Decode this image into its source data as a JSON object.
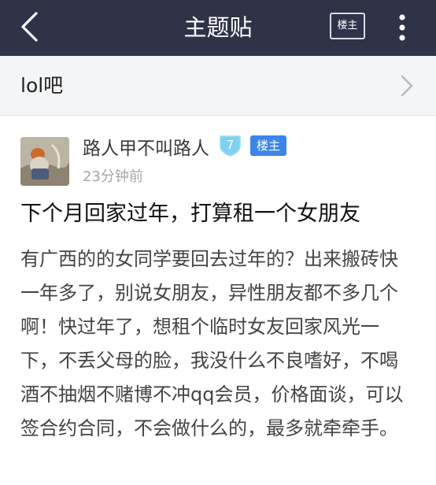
{
  "header": {
    "title": "主题贴",
    "op_only_label": "楼主",
    "back_icon": "back-arrow-icon",
    "more_icon": "more-vertical-icon",
    "background": "#2e3347"
  },
  "forum": {
    "name": "lol吧"
  },
  "post": {
    "author": "路人甲不叫路人",
    "level": "7",
    "op_badge": "楼主",
    "time": "23分钟前",
    "title": "下个月回家过年，打算租一个女朋友",
    "body": "有广西的的女同学要回去过年的？出来搬砖快一年多了，别说女朋友，异性朋友都不多几个啊！快过年了，想租个临时女友回家风光一下，不丢父母的脸，我没什么不良嗜好，不喝酒不抽烟不赌博不冲qq会员，价格面谈，可以签合约合同，不会做什么的，最多就牵牵手。"
  },
  "colors": {
    "accent_blue": "#3b86e8",
    "level_badge": "#7fd1f2"
  }
}
